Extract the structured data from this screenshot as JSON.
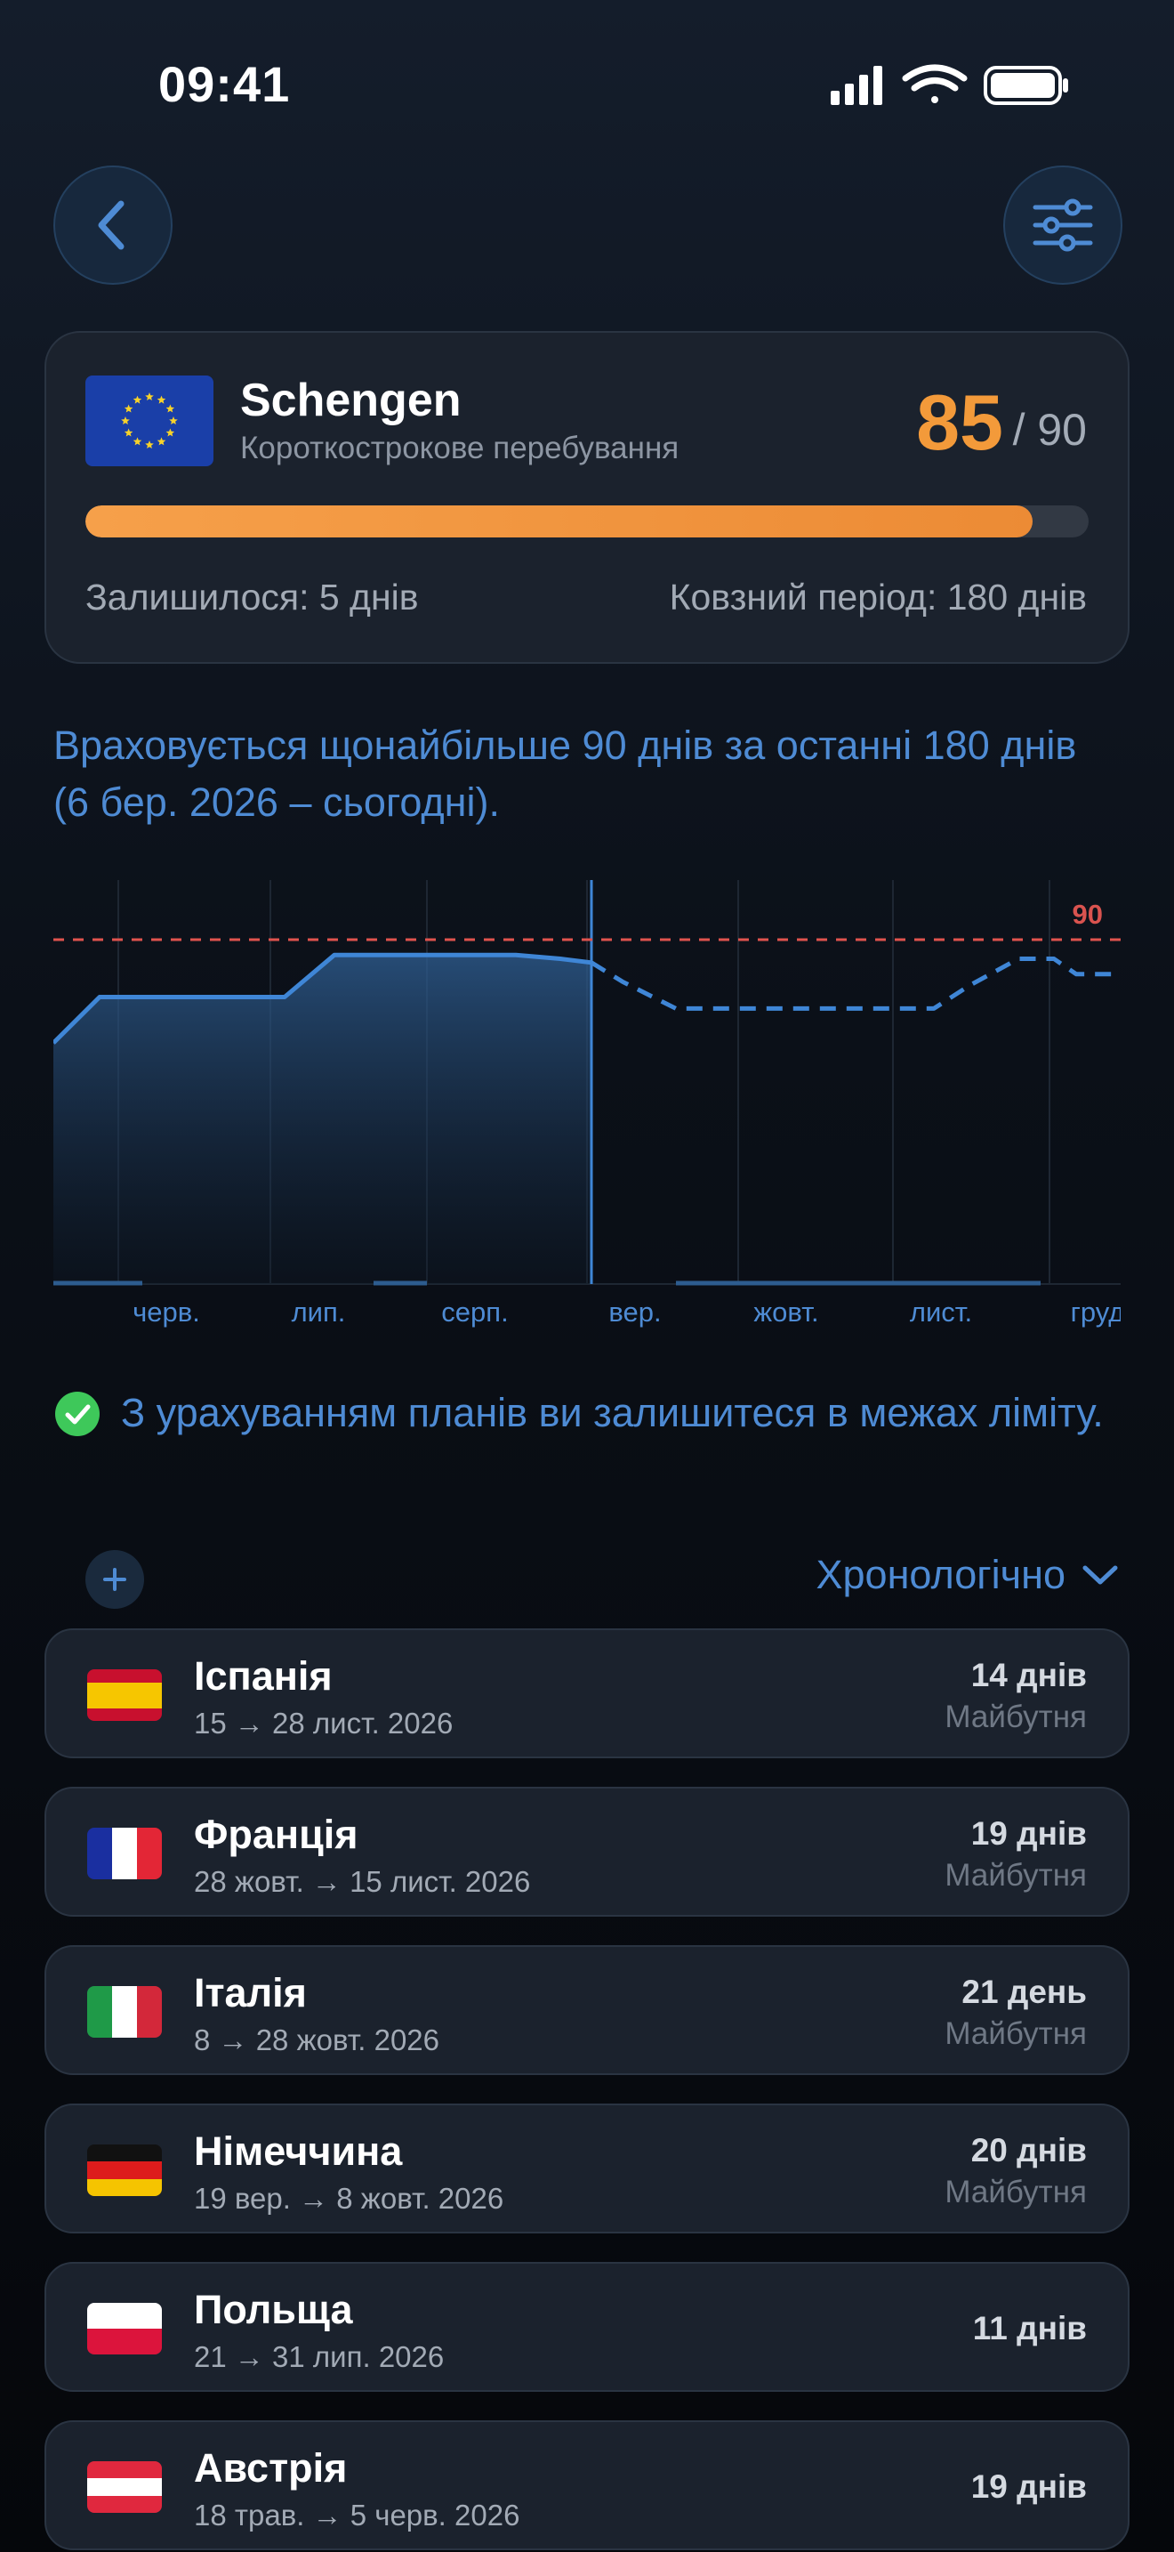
{
  "status_bar": {
    "time": "09:41"
  },
  "header": {
    "back_icon": "chevron-left-icon",
    "filter_icon": "sliders-icon"
  },
  "summary": {
    "zone": "Schengen",
    "subtitle": "Короткострокове перебування",
    "used": "85",
    "limit": "/ 90",
    "progress_fraction": 0.944,
    "remaining": "Залишилося: 5 днів",
    "rolling_period": "Ковзний період: 180 днів",
    "accent": "#f39a3a"
  },
  "info_text": "Враховується щонайбільше 90 днів за останні 180 днів (6 бер. 2026 – сьогодні).",
  "chart_data": {
    "type": "area",
    "x_labels": [
      "черв.",
      "лип.",
      "серп.",
      "вер.",
      "жовт.",
      "лист.",
      "груд"
    ],
    "limit_label": "90",
    "limit_value": 90,
    "ylim": [
      0,
      100
    ],
    "today_index": 12,
    "series": [
      {
        "style": "solid",
        "values": [
          63,
          75,
          75,
          75,
          75,
          75,
          86,
          86,
          86,
          86,
          86,
          85,
          84
        ]
      },
      {
        "style": "dashed",
        "values": [
          84,
          79,
          72,
          72,
          72,
          72,
          72,
          72,
          78,
          85,
          85,
          81,
          81
        ]
      }
    ],
    "grid": true,
    "colors": {
      "line": "#3f86d6",
      "limit": "#e0534e",
      "limit_label": "#d9534f"
    }
  },
  "status_message": "З урахуванням планів ви залишитеся в межах ліміту.",
  "sort_label": "Хронологічно",
  "trips": [
    {
      "country": "Іспанія",
      "dates": "15 → 28 лист. 2026",
      "days": "14 днів",
      "status": "Майбутня",
      "flag": "es"
    },
    {
      "country": "Франція",
      "dates": "28 жовт. → 15 лист. 2026",
      "days": "19 днів",
      "status": "Майбутня",
      "flag": "fr"
    },
    {
      "country": "Італія",
      "dates": "8 → 28 жовт. 2026",
      "days": "21 день",
      "status": "Майбутня",
      "flag": "it"
    },
    {
      "country": "Німеччина",
      "dates": "19 вер. → 8 жовт. 2026",
      "days": "20 днів",
      "status": "Майбутня",
      "flag": "de"
    },
    {
      "country": "Польща",
      "dates": "21 → 31 лип. 2026",
      "days": "11 днів",
      "status": "",
      "flag": "pl"
    },
    {
      "country": "Австрія",
      "dates": "18 трав. → 5 черв. 2026",
      "days": "19 днів",
      "status": "",
      "flag": "at"
    }
  ]
}
